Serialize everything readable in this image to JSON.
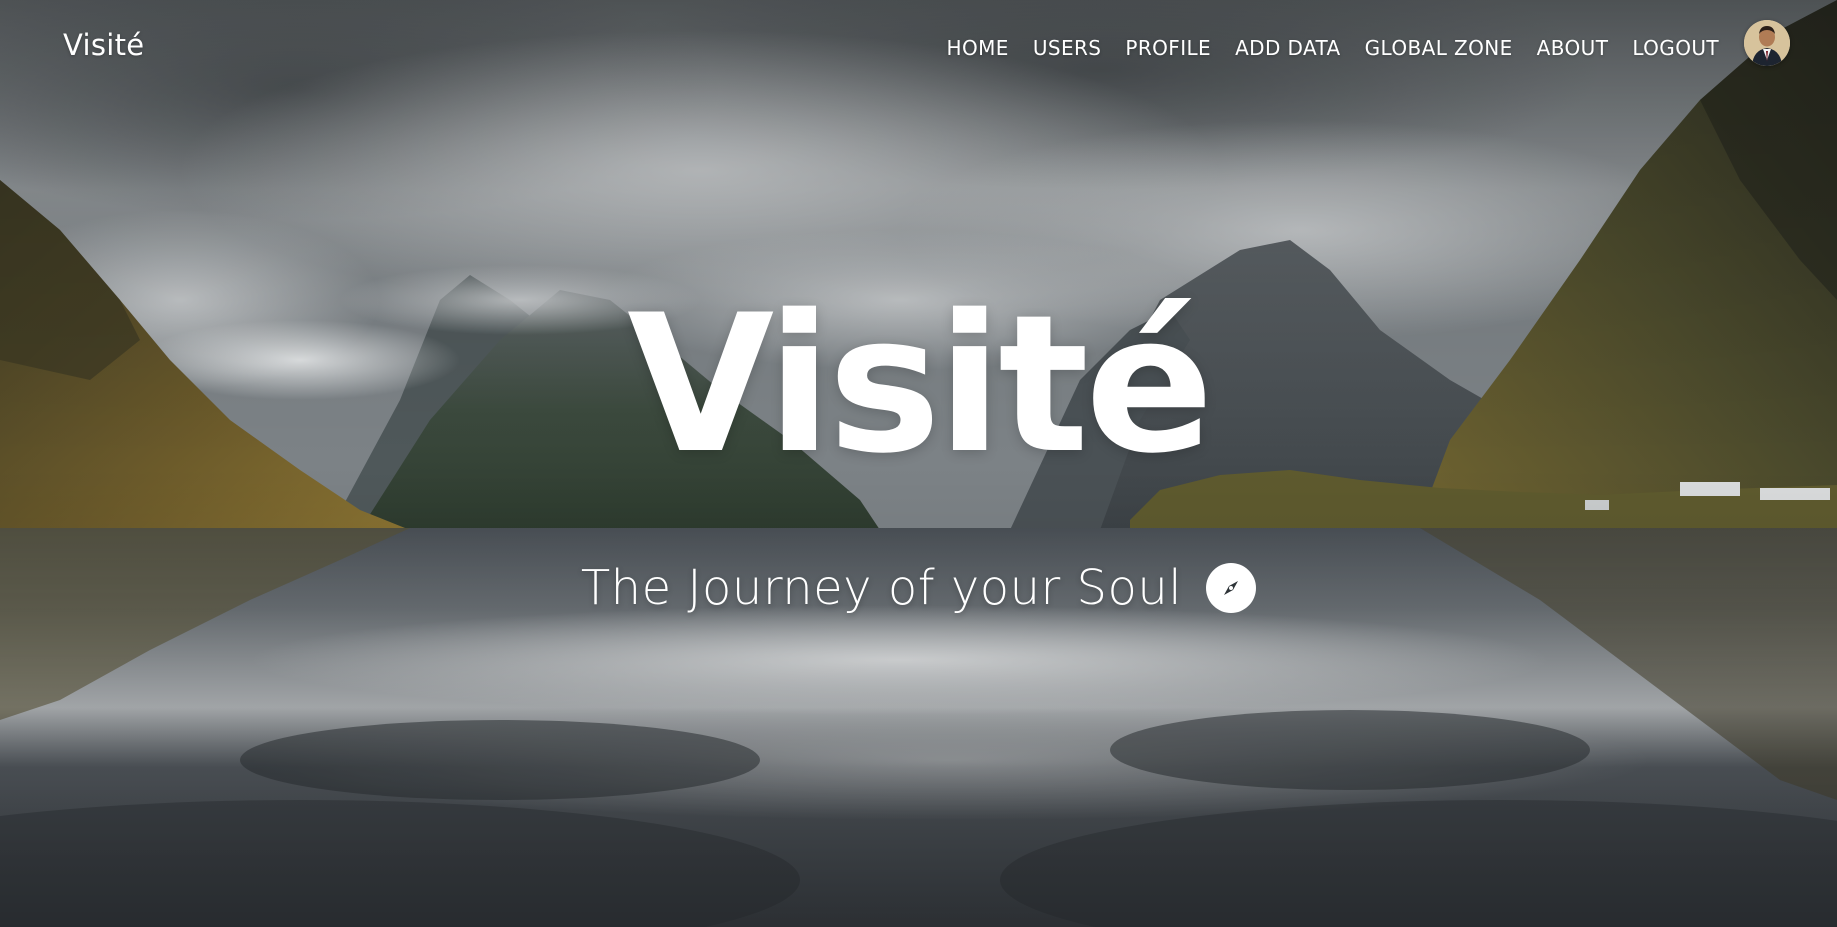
{
  "navbar": {
    "brand": "Visité",
    "links": [
      {
        "label": "HOME"
      },
      {
        "label": "USERS"
      },
      {
        "label": "PROFILE"
      },
      {
        "label": "ADD DATA"
      },
      {
        "label": "GLOBAL ZONE"
      },
      {
        "label": "ABOUT"
      },
      {
        "label": "LOGOUT"
      }
    ],
    "avatar_icon": "user-avatar"
  },
  "hero": {
    "title": "Visité",
    "tagline": "The Journey of your Soul",
    "tagline_icon": "compass-icon"
  },
  "colors": {
    "text": "#ffffff",
    "sky": "#8a9094",
    "water": "#3c4147",
    "mountain": "#2f3a36"
  }
}
